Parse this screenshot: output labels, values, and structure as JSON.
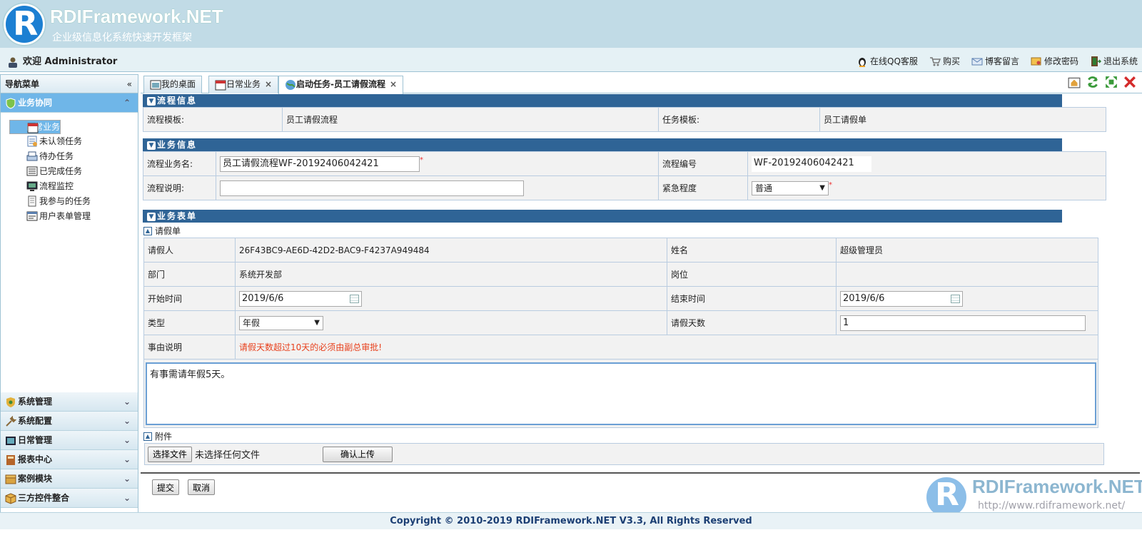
{
  "header": {
    "logo_letter": "R",
    "title": "RDIFramework.NET",
    "subtitle": "企业级信息化系统快速开发框架"
  },
  "topbar": {
    "welcome": "欢迎 Administrator",
    "links": [
      "在线QQ客服",
      "购买",
      "博客留言",
      "修改密码",
      "退出系统"
    ]
  },
  "sidebar": {
    "title": "导航菜单",
    "collapse_glyph": "«",
    "active_group": "业务协同",
    "items": [
      "日常业务",
      "未认领任务",
      "待办任务",
      "已完成任务",
      "流程监控",
      "我参与的任务",
      "用户表单管理"
    ],
    "groups": [
      "系统管理",
      "系统配置",
      "日常管理",
      "报表中心",
      "案例模块",
      "三方控件整合"
    ]
  },
  "tabs": [
    {
      "label": "我的桌面"
    },
    {
      "label": "日常业务",
      "close": "×"
    },
    {
      "label": "启动任务-员工请假流程",
      "close": "×"
    }
  ],
  "process_info": {
    "title": "流程信息",
    "template_label": "流程模板:",
    "template_value": "员工请假流程",
    "task_label": "任务模板:",
    "task_value": "员工请假单"
  },
  "business_info": {
    "title": "业务信息",
    "name_label": "流程业务名:",
    "name_value": "员工请假流程WF-20192406042421",
    "code_label": "流程编号",
    "code_value": "WF-20192406042421",
    "desc_label": "流程说明:",
    "desc_value": "",
    "urgency_label": "紧急程度",
    "urgency_value": "普通",
    "required_mark": "*"
  },
  "business_form": {
    "title": "业务表单",
    "sub_title": "请假单",
    "applicant_label": "请假人",
    "applicant_value": "26F43BC9-AE6D-42D2-BAC9-F4237A949484",
    "name_label": "姓名",
    "name_value": "超级管理员",
    "dept_label": "部门",
    "dept_value": "系统开发部",
    "post_label": "岗位",
    "post_value": "",
    "start_label": "开始时间",
    "start_value": "2019/6/6",
    "end_label": "结束时间",
    "end_value": "2019/6/6",
    "type_label": "类型",
    "type_value": "年假",
    "days_label": "请假天数",
    "days_value": "1",
    "reason_label": "事由说明",
    "reason_note": "请假天数超过10天的必须由副总审批!",
    "reason_text": "有事需请年假5天。"
  },
  "attachment": {
    "title": "附件",
    "choose_button": "选择文件",
    "no_file": "未选择任何文件",
    "upload_button": "确认上传"
  },
  "actions": {
    "submit": "提交",
    "cancel": "取消"
  },
  "footer": "Copyright © 2010-2019 RDIFramework.NET V3.3, All Rights Reserved",
  "watermark": {
    "letter": "R",
    "title": "RDIFramework.NET",
    "url": "http://www.rdiframework.net/"
  },
  "colors": {
    "header_bg": "#c1dbe6",
    "section_bar": "#2f6496",
    "selection": "#6fb6e8",
    "warning_text": "#e8401c"
  }
}
